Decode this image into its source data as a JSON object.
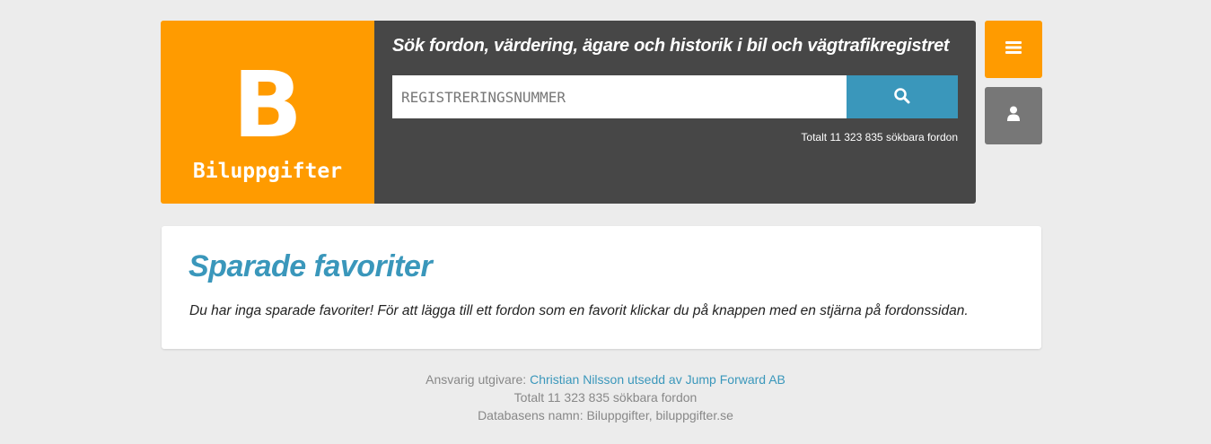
{
  "header": {
    "logo_letter": "B",
    "logo_name": "Biluppgifter",
    "search_title": "Sök fordon, värdering, ägare och historik i bil och vägtrafikregistret",
    "search_placeholder": "REGISTRERINGSNUMMER",
    "search_value": "",
    "search_icon": "search-icon",
    "total_text": "Totalt 11 323 835 sökbara fordon"
  },
  "side_buttons": {
    "menu_icon": "hamburger-menu-icon",
    "user_icon": "user-icon"
  },
  "main": {
    "title": "Sparade favoriter",
    "message": "Du har inga sparade favoriter! För att lägga till ett fordon som en favorit klickar du på knappen med en stjärna på fordonssidan."
  },
  "footer": {
    "publisher_label": "Ansvarig utgivare:",
    "publisher_link": "Christian Nilsson utsedd av Jump Forward AB",
    "total_text": "Totalt 11 323 835 sökbara fordon",
    "database_text": "Databasens namn: Biluppgifter, biluppgifter.se"
  },
  "colors": {
    "brand_orange": "#ff9b00",
    "accent_blue": "#3a97bb",
    "panel_dark": "#474747",
    "user_button_gray": "#777777",
    "page_background": "#ececec"
  }
}
